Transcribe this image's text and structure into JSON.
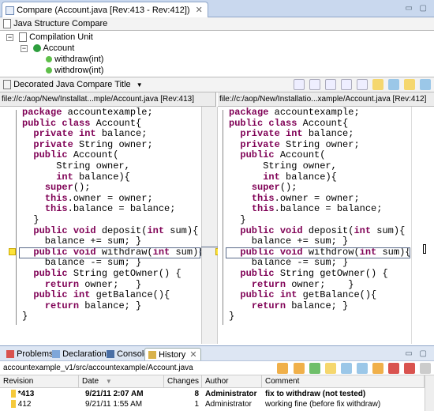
{
  "editor": {
    "tab_title": "Compare (Account.java [Rev:413 - Rev:412])"
  },
  "structure": {
    "title": "Java Structure Compare",
    "tree": {
      "root": "Compilation Unit",
      "class": "Account",
      "methods": [
        "withdraw(int)",
        "withdrow(int)"
      ]
    }
  },
  "compare_bar": {
    "title": "Decorated Java Compare Title"
  },
  "left": {
    "header": "file://c:/aop/New/Installat...mple/Account.java [Rev:413]",
    "lines": [
      "package accountexample;",
      "public class Account{",
      "  private int balance;",
      "  private String owner;",
      "  public Account(",
      "      String owner,",
      "      int balance){",
      "    super();",
      "    this.owner = owner;",
      "    this.balance = balance;",
      "  }",
      "  public void deposit(int sum){",
      "    balance += sum; }",
      "  public void withdraw(int sum){",
      "    balance -= sum; }",
      "  public String getOwner() {",
      "    return owner;   }",
      "  public int getBalance(){",
      "    return balance; }",
      "}"
    ]
  },
  "right": {
    "header": "file://c:/aop/New/Installatio...xample/Account.java [Rev:412]",
    "lines": [
      "package accountexample;",
      "public class Account{",
      "  private int balance;",
      "  private String owner;",
      "  public Account(",
      "      String owner,",
      "      int balance){",
      "    super();",
      "    this.owner = owner;",
      "    this.balance = balance;",
      "  }",
      "  public void deposit(int sum){",
      "    balance += sum; }",
      "  public void withdrow(int sum){",
      "    balance -= sum; }",
      "  public String getOwner() {",
      "    return owner;    }",
      "  public int getBalance(){",
      "    return balance; }",
      "}"
    ]
  },
  "bottom_tabs": [
    "Problems",
    "Declaration",
    "Console",
    "History"
  ],
  "history": {
    "path": "accountexample_v1/src/accountexample/Account.java",
    "columns": [
      "Revision",
      "Date",
      "Changes",
      "Author",
      "Comment"
    ],
    "rows": [
      {
        "revision": "*413",
        "date": "9/21/11 2:07 AM",
        "changes": "8",
        "author": "Administrator",
        "comment": "fix to withdraw (not tested)"
      },
      {
        "revision": "412",
        "date": "9/21/11 1:55 AM",
        "changes": "1",
        "author": "Administrator",
        "comment": "working fine (before fix withdraw)"
      }
    ]
  },
  "colors": {
    "keyword": "#7f0055",
    "diff_marker": "#fde33b",
    "tab_blue": "#c9d8ee"
  },
  "icons": [
    "java-file-icon",
    "class-icon",
    "method-icon",
    "warning-icon",
    "dropdown-icon"
  ]
}
